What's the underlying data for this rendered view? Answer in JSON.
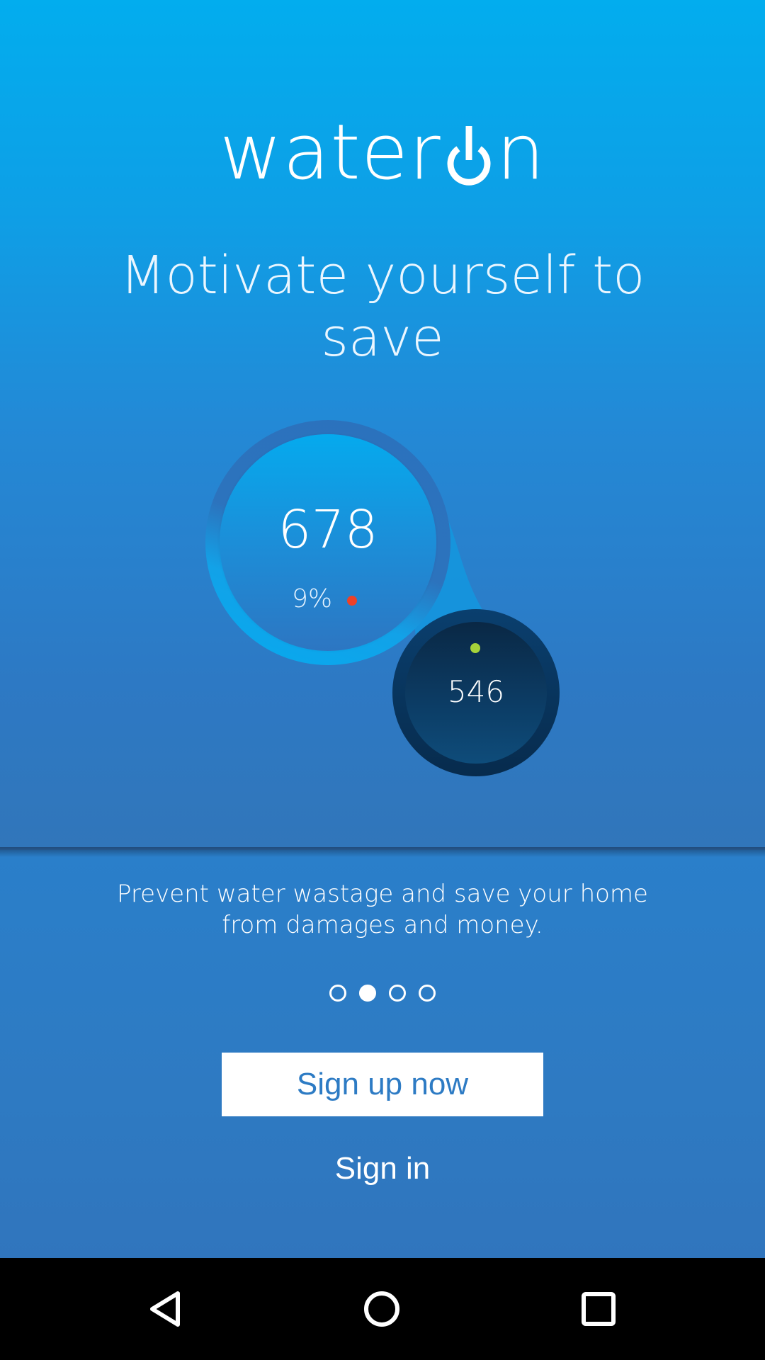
{
  "app": {
    "logo_text_start": "water",
    "logo_text_end": "n",
    "logo_icon": "power-icon"
  },
  "onboarding": {
    "headline": "Motivate yourself to save",
    "gauge_primary": {
      "value": "678",
      "percent": "9%",
      "indicator_color": "#ee4128"
    },
    "gauge_secondary": {
      "value": "546",
      "indicator_color": "#a6d33a"
    },
    "description": "Prevent water wastage and save your home from damages and money.",
    "pager": {
      "total": 4,
      "active_index": 1
    },
    "signup_label": "Sign up now",
    "signin_label": "Sign in"
  },
  "navbar": {
    "back_icon": "back-triangle-icon",
    "home_icon": "home-circle-icon",
    "recent_icon": "recent-apps-square-icon"
  },
  "colors": {
    "accent": "#2d7bc4",
    "top_gradient": "#02adee",
    "bottom_gradient": "#3176ba"
  }
}
